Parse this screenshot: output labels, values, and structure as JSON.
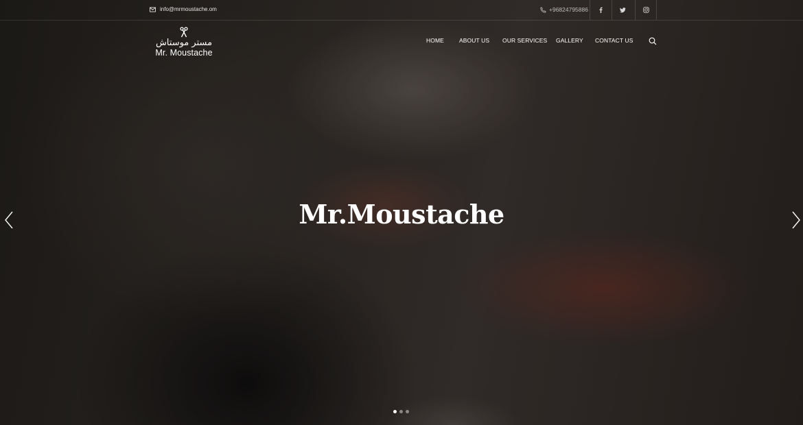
{
  "topbar": {
    "email": "info@mrmoustache.om",
    "phone": "+96824795886",
    "social": [
      {
        "name": "facebook",
        "icon": "facebook-icon"
      },
      {
        "name": "twitter",
        "icon": "twitter-icon"
      },
      {
        "name": "instagram",
        "icon": "instagram-icon"
      }
    ]
  },
  "logo": {
    "arabic": "مستر موستاش",
    "latin": "Mr. Moustache",
    "icon": "scissors-comb-icon"
  },
  "nav": {
    "items": [
      "HOME",
      "ABOUT US",
      "OUR SERVICES",
      "GALLERY",
      "CONTACT US"
    ],
    "search_icon": "search-icon"
  },
  "slider": {
    "title": "Mr.Moustache",
    "slide_count": 3,
    "active_slide": 1,
    "prev_icon": "chevron-left-icon",
    "next_icon": "chevron-right-icon"
  },
  "colors": {
    "text": "#ffffff",
    "muted": "#bdbdbd",
    "overlay": "#1b1816"
  }
}
